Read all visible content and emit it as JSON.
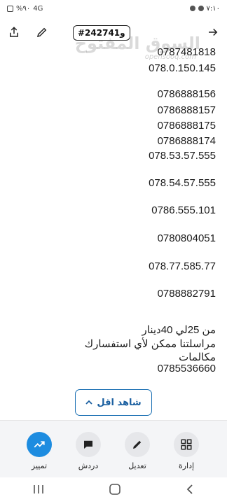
{
  "status_bar": {
    "time": "٧:١٠",
    "battery": "%٩٠",
    "network": "4G"
  },
  "header": {
    "ad_number": "#242741",
    "ad_suffix": "و",
    "watermark": "السوق المفتوح",
    "watermark_sub": "opensooq.com"
  },
  "description_lines": [
    "0787481818",
    "078.0.150.145",
    "0786888156",
    "0786888157",
    "0786888175",
    "0786888174",
    "078.53.57.555",
    "078.54.57.555",
    "0786.555.101",
    "0780804051",
    "078.77.585.77",
    "0788882791"
  ],
  "footer_text": [
    "من 25لي 40دينار",
    "مراسلتنا ممكن لأي استفسارك",
    "مكالمات",
    "0785536660"
  ],
  "show_less_label": "شاهد اقل",
  "bottom_nav": [
    {
      "label": "تمييز",
      "icon": "trending-up-icon",
      "active": true
    },
    {
      "label": "دردش",
      "icon": "chat-icon",
      "active": false
    },
    {
      "label": "تعديل",
      "icon": "pencil-icon",
      "active": false
    },
    {
      "label": "إدارة",
      "icon": "grid-icon",
      "active": false
    }
  ],
  "colors": {
    "accent": "#1d8ce0",
    "link": "#1a5fa0"
  }
}
